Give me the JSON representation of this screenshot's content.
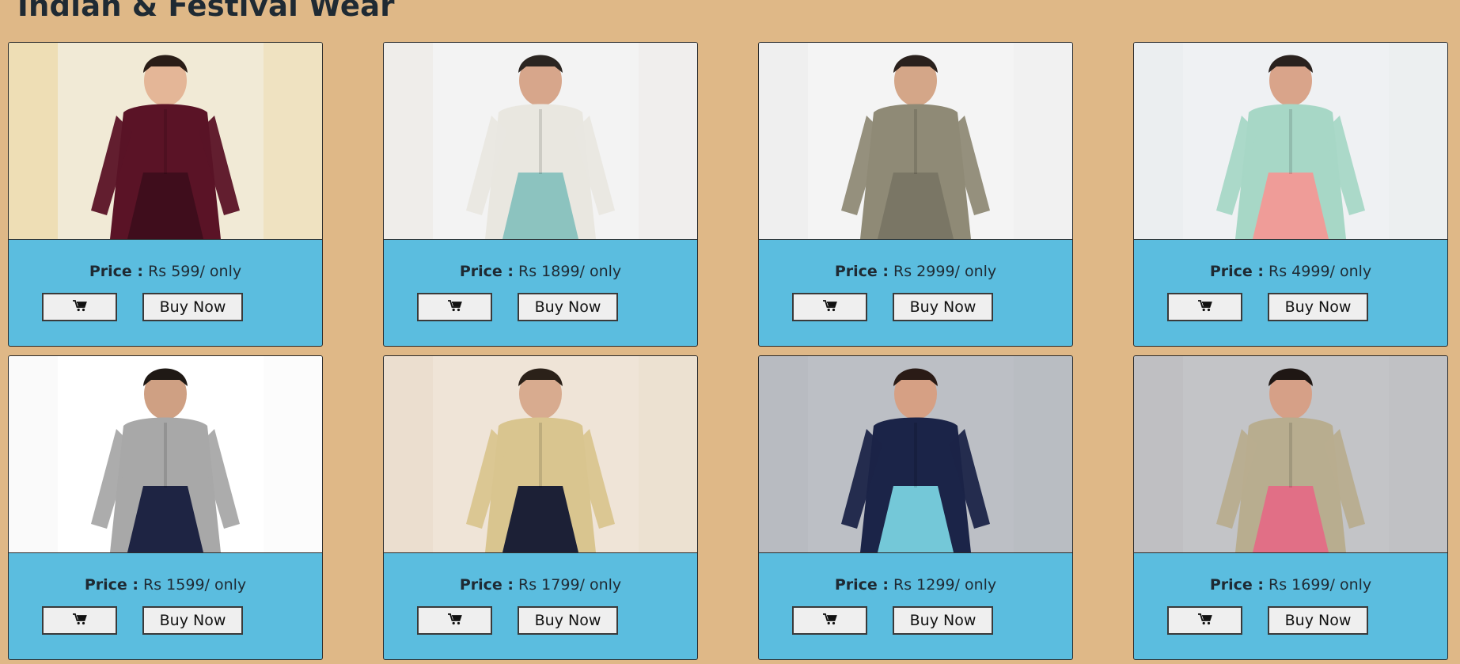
{
  "page": {
    "title": "Indian & Festival Wear"
  },
  "products": [
    {
      "price_label": "Price :",
      "price_text": "Rs 599/ only",
      "buy_label": "Buy Now",
      "cart_icon": "cart-icon",
      "image": {
        "bg": "#f1ead6",
        "accent": "#e8c877",
        "top": "#5a1326",
        "bottom": "#3f0d1c",
        "skin": "#e4b697",
        "hair": "#2a1d17"
      }
    },
    {
      "price_label": "Price :",
      "price_text": "Rs 1899/ only",
      "buy_label": "Buy Now",
      "cart_icon": "cart-icon",
      "image": {
        "bg": "#f3f3f3",
        "accent": "#e8e1da",
        "top": "#e9e7e0",
        "bottom": "#8cc3bf",
        "skin": "#d7a68b",
        "hair": "#2b2521"
      }
    },
    {
      "price_label": "Price :",
      "price_text": "Rs 2999/ only",
      "buy_label": "Buy Now",
      "cart_icon": "cart-icon",
      "image": {
        "bg": "#f4f4f4",
        "accent": "#e6e6e6",
        "top": "#8f8a76",
        "bottom": "#7a7665",
        "skin": "#d4a688",
        "hair": "#2a211d"
      }
    },
    {
      "price_label": "Price :",
      "price_text": "Rs 4999/ only",
      "buy_label": "Buy Now",
      "cart_icon": "cart-icon",
      "image": {
        "bg": "#eff1f3",
        "accent": "#e4e7ea",
        "top": "#a7d7c6",
        "bottom": "#ef9c98",
        "skin": "#d9a48a",
        "hair": "#2a221e"
      }
    },
    {
      "price_label": "Price :",
      "price_text": "Rs 1599/ only",
      "buy_label": "Buy Now",
      "cart_icon": "cart-icon",
      "image": {
        "bg": "#ffffff",
        "accent": "#f0f0f0",
        "top": "#a8a8a8",
        "bottom": "#1e2443",
        "skin": "#cfa083",
        "hair": "#1f1915"
      }
    },
    {
      "price_label": "Price :",
      "price_text": "Rs 1799/ only",
      "buy_label": "Buy Now",
      "cart_icon": "cart-icon",
      "image": {
        "bg": "#efe4d7",
        "accent": "#e4d5c1",
        "top": "#d9c58f",
        "bottom": "#1c2036",
        "skin": "#d8ab8f",
        "hair": "#2b2119"
      }
    },
    {
      "price_label": "Price :",
      "price_text": "Rs 1299/ only",
      "buy_label": "Buy Now",
      "cart_icon": "cart-icon",
      "image": {
        "bg": "#bcbfc5",
        "accent": "#b1b4bb",
        "top": "#1b2448",
        "bottom": "#74c8d8",
        "skin": "#d6a084",
        "hair": "#2a1b16"
      }
    },
    {
      "price_label": "Price :",
      "price_text": "Rs 1699/ only",
      "buy_label": "Buy Now",
      "cart_icon": "cart-icon",
      "image": {
        "bg": "#c3c4c7",
        "accent": "#b7b8bb",
        "top": "#b8ad8f",
        "bottom": "#e16f86",
        "skin": "#d6a087",
        "hair": "#1f1714"
      }
    }
  ]
}
